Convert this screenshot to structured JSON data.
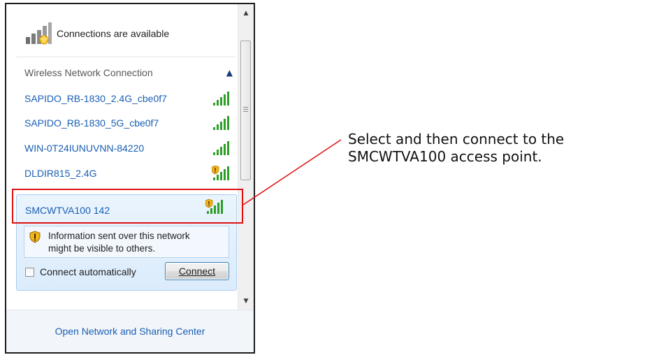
{
  "flyout": {
    "status_text": "Connections are available",
    "section_title": "Wireless Network Connection",
    "networks": [
      {
        "name": "SAPIDO_RB-1830_2.4G_cbe0f7",
        "secured": true
      },
      {
        "name": "SAPIDO_RB-1830_5G_cbe0f7",
        "secured": true
      },
      {
        "name": "WIN-0T24IUNUVNN-84220",
        "secured": true
      },
      {
        "name": "DLDIR815_2.4G",
        "secured": false
      }
    ],
    "selected": {
      "name": "SMCWTVA100 142",
      "warning_line1": "Information sent over this network",
      "warning_line2": "might be visible to others.",
      "auto_connect_label": "Connect automatically",
      "auto_connect_checked": false,
      "connect_button_label": "Connect"
    },
    "footer_link": "Open Network and Sharing Center"
  },
  "callout": {
    "line1": "Select and then connect to the",
    "line2": "SMCWTVA100 access point.",
    "color": "#e01010"
  },
  "colors": {
    "link": "#1a5fb4",
    "signal_green": "#2e9e28",
    "warning_yellow": "#f2b31c"
  }
}
